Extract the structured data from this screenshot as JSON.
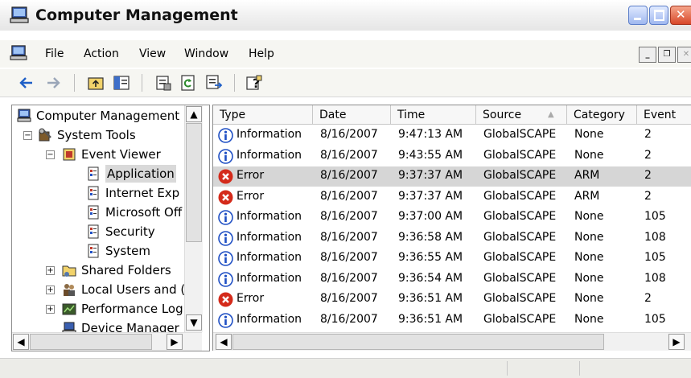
{
  "window": {
    "title": "Computer Management"
  },
  "menu": {
    "items": [
      "File",
      "Action",
      "View",
      "Window",
      "Help"
    ]
  },
  "toolbar": {
    "buttons": [
      "back-icon",
      "forward-icon",
      "up-folder-icon",
      "show-hide-tree-icon",
      "properties-icon",
      "refresh-icon",
      "export-list-icon",
      "help-icon"
    ]
  },
  "tree": {
    "items": [
      {
        "label": "Computer Management (",
        "icon": "computer-icon"
      },
      {
        "label": "System Tools",
        "icon": "tools-icon"
      },
      {
        "label": "Event Viewer",
        "icon": "event-viewer-icon"
      },
      {
        "label": "Application",
        "icon": "log-icon",
        "selected": true
      },
      {
        "label": "Internet Exp",
        "icon": "log-icon"
      },
      {
        "label": "Microsoft Off",
        "icon": "log-icon"
      },
      {
        "label": "Security",
        "icon": "log-icon"
      },
      {
        "label": "System",
        "icon": "log-icon"
      },
      {
        "label": "Shared Folders",
        "icon": "folder-icon"
      },
      {
        "label": "Local Users and (",
        "icon": "users-icon"
      },
      {
        "label": "Performance Log",
        "icon": "performance-icon"
      },
      {
        "label": "Device Manager",
        "icon": "device-manager-icon"
      }
    ]
  },
  "list": {
    "columns": [
      "Type",
      "Date",
      "Time",
      "Source",
      "Category",
      "Event"
    ],
    "rows": [
      {
        "type": "Information",
        "date": "8/16/2007",
        "time": "9:47:13 AM",
        "source": "GlobalSCAPE",
        "category": "None",
        "event": "2"
      },
      {
        "type": "Information",
        "date": "8/16/2007",
        "time": "9:43:55 AM",
        "source": "GlobalSCAPE",
        "category": "None",
        "event": "2"
      },
      {
        "type": "Error",
        "date": "8/16/2007",
        "time": "9:37:37 AM",
        "source": "GlobalSCAPE",
        "category": "ARM",
        "event": "2",
        "selected": true
      },
      {
        "type": "Error",
        "date": "8/16/2007",
        "time": "9:37:37 AM",
        "source": "GlobalSCAPE",
        "category": "ARM",
        "event": "2"
      },
      {
        "type": "Information",
        "date": "8/16/2007",
        "time": "9:37:00 AM",
        "source": "GlobalSCAPE",
        "category": "None",
        "event": "105"
      },
      {
        "type": "Information",
        "date": "8/16/2007",
        "time": "9:36:58 AM",
        "source": "GlobalSCAPE",
        "category": "None",
        "event": "108"
      },
      {
        "type": "Information",
        "date": "8/16/2007",
        "time": "9:36:55 AM",
        "source": "GlobalSCAPE",
        "category": "None",
        "event": "105"
      },
      {
        "type": "Information",
        "date": "8/16/2007",
        "time": "9:36:54 AM",
        "source": "GlobalSCAPE",
        "category": "None",
        "event": "108"
      },
      {
        "type": "Error",
        "date": "8/16/2007",
        "time": "9:36:51 AM",
        "source": "GlobalSCAPE",
        "category": "None",
        "event": "2"
      },
      {
        "type": "Information",
        "date": "8/16/2007",
        "time": "9:36:51 AM",
        "source": "GlobalSCAPE",
        "category": "None",
        "event": "105"
      }
    ]
  },
  "colors": {
    "info_blue": "#1f4fc4",
    "error_red": "#d42a1a",
    "selection": "#d6d6d6"
  }
}
